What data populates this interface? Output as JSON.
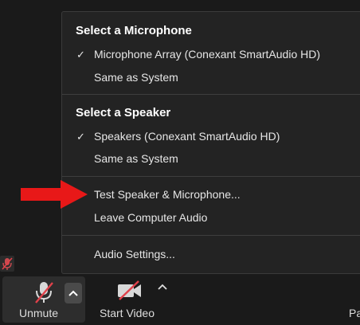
{
  "menu": {
    "microphone": {
      "heading": "Select a Microphone",
      "items": [
        {
          "label": "Microphone Array (Conexant SmartAudio HD)",
          "selected": true
        },
        {
          "label": "Same as System",
          "selected": false
        }
      ]
    },
    "speaker": {
      "heading": "Select a Speaker",
      "items": [
        {
          "label": "Speakers (Conexant SmartAudio HD)",
          "selected": true
        },
        {
          "label": "Same as System",
          "selected": false
        }
      ]
    },
    "actions": {
      "test": "Test Speaker & Microphone...",
      "leave": "Leave Computer Audio"
    },
    "settings": "Audio Settings...",
    "check_glyph": "✓"
  },
  "toolbar": {
    "unmute_label": "Unmute",
    "video_label": "Start Video",
    "partial_label": "Pa"
  },
  "colors": {
    "highlight_arrow": "#e81818",
    "muted_slash": "#e0414a",
    "menu_bg": "#232323"
  },
  "icons": {
    "mic": "microphone-muted-icon",
    "video": "video-off-icon",
    "caret": "chevron-up-icon"
  }
}
